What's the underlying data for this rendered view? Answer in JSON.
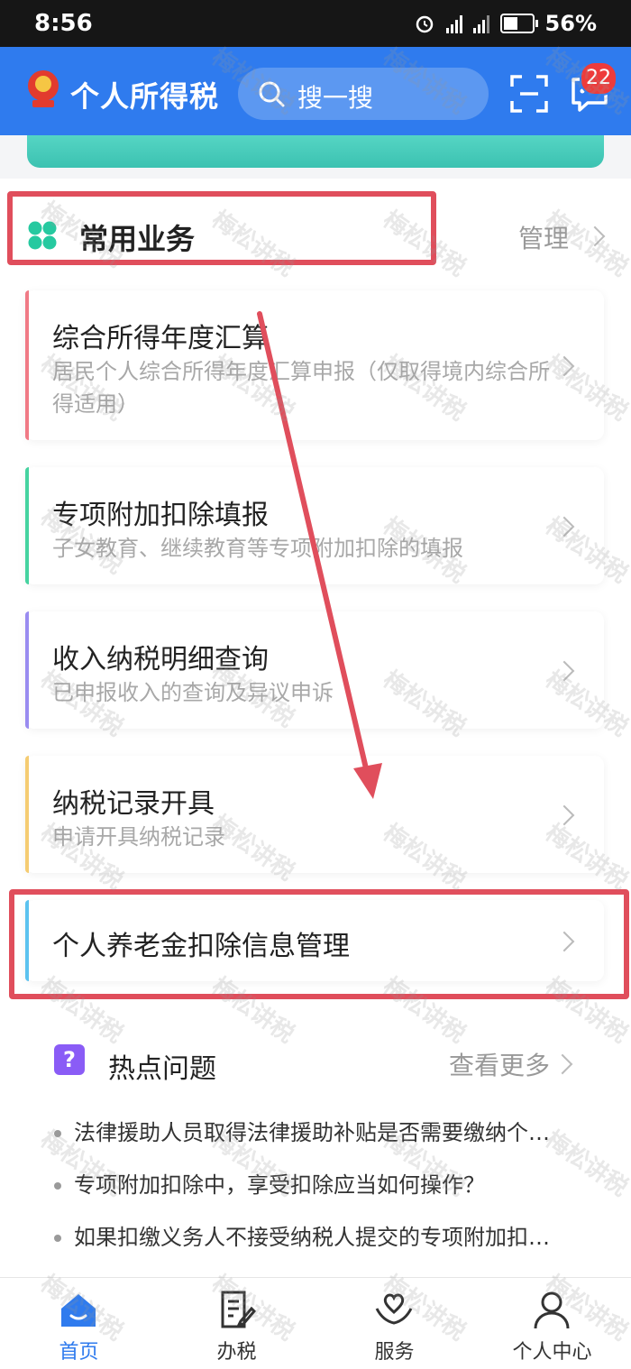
{
  "status_bar": {
    "time": "8:56",
    "battery": "56%"
  },
  "header": {
    "title": "个人所得税",
    "search_placeholder": "搜一搜",
    "message_badge": "22"
  },
  "common": {
    "title": "常用业务",
    "manage": "管理",
    "items": [
      {
        "title": "综合所得年度汇算",
        "desc": "居民个人综合所得年度汇算申报（仅取得境内综合所得适用）",
        "color": "#f07a86"
      },
      {
        "title": "专项附加扣除填报",
        "desc": "子女教育、继续教育等专项附加扣除的填报",
        "color": "#46d3a0"
      },
      {
        "title": "收入纳税明细查询",
        "desc": "已申报收入的查询及异议申诉",
        "color": "#9a8cf0"
      },
      {
        "title": "纳税记录开具",
        "desc": "申请开具纳税记录",
        "color": "#f5cc72"
      },
      {
        "title": "个人养老金扣除信息管理",
        "desc": "",
        "color": "#5bc2ef"
      }
    ]
  },
  "hot": {
    "icon_text": "?",
    "title": "热点问题",
    "more": "查看更多",
    "questions": [
      "法律援助人员取得法律援助补贴是否需要缴纳个…",
      "专项附加扣除中，享受扣除应当如何操作？",
      "如果扣缴义务人不接受纳税人提交的专项附加扣…"
    ]
  },
  "tabs": [
    {
      "label": "首页"
    },
    {
      "label": "办税"
    },
    {
      "label": "服务"
    },
    {
      "label": "个人中心"
    }
  ],
  "watermark": "梅松讲税",
  "colors": {
    "brand": "#2f7bee",
    "highlight": "#e04e5c"
  }
}
